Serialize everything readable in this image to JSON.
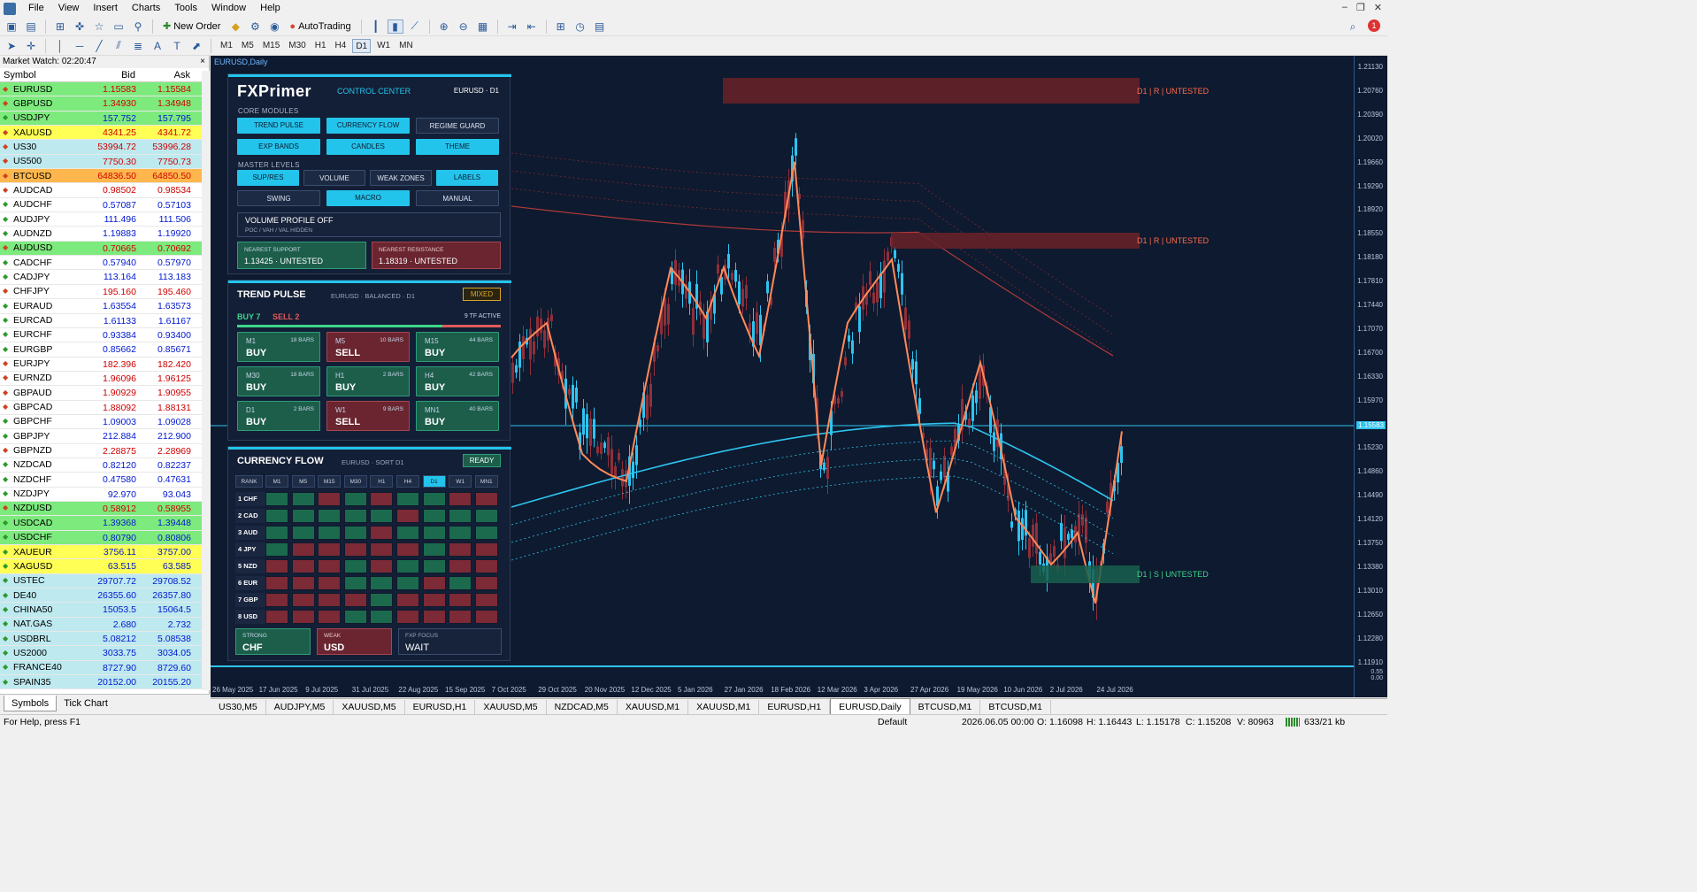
{
  "menu": [
    "File",
    "View",
    "Insert",
    "Charts",
    "Tools",
    "Window",
    "Help"
  ],
  "toolbar": {
    "new_order": "New Order",
    "autotrading": "AutoTrading",
    "timeframes": [
      "M1",
      "M5",
      "M15",
      "M30",
      "H1",
      "H4",
      "D1",
      "W1",
      "MN"
    ],
    "active_tf": "D1"
  },
  "market_watch": {
    "title": "Market Watch: 02:20:47",
    "col_symbol": "Symbol",
    "col_bid": "Bid",
    "col_ask": "Ask",
    "rows": [
      {
        "s": "EURUSD",
        "b": "1.15583",
        "a": "1.15584",
        "bg": "#7dea7d",
        "dir": "dn"
      },
      {
        "s": "GBPUSD",
        "b": "1.34930",
        "a": "1.34948",
        "bg": "#7dea7d",
        "dir": "dn"
      },
      {
        "s": "USDJPY",
        "b": "157.752",
        "a": "157.795",
        "bg": "#7dea7d",
        "dir": "up"
      },
      {
        "s": "XAUUSD",
        "b": "4341.25",
        "a": "4341.72",
        "bg": "#ffff55",
        "dir": "dn"
      },
      {
        "s": "US30",
        "b": "53994.72",
        "a": "53996.28",
        "bg": "#bde9ef",
        "dir": "dn"
      },
      {
        "s": "US500",
        "b": "7750.30",
        "a": "7750.73",
        "bg": "#bde9ef",
        "dir": "dn"
      },
      {
        "s": "BTCUSD",
        "b": "64836.50",
        "a": "64850.50",
        "bg": "#ffb74d",
        "dir": "dn"
      },
      {
        "s": "AUDCAD",
        "b": "0.98502",
        "a": "0.98534",
        "bg": "#ffffff",
        "dir": "dn"
      },
      {
        "s": "AUDCHF",
        "b": "0.57087",
        "a": "0.57103",
        "bg": "#ffffff",
        "dir": "up"
      },
      {
        "s": "AUDJPY",
        "b": "111.496",
        "a": "111.506",
        "bg": "#ffffff",
        "dir": "up"
      },
      {
        "s": "AUDNZD",
        "b": "1.19883",
        "a": "1.19920",
        "bg": "#ffffff",
        "dir": "up"
      },
      {
        "s": "AUDUSD",
        "b": "0.70665",
        "a": "0.70692",
        "bg": "#7dea7d",
        "dir": "dn"
      },
      {
        "s": "CADCHF",
        "b": "0.57940",
        "a": "0.57970",
        "bg": "#ffffff",
        "dir": "up"
      },
      {
        "s": "CADJPY",
        "b": "113.164",
        "a": "113.183",
        "bg": "#ffffff",
        "dir": "up"
      },
      {
        "s": "CHFJPY",
        "b": "195.160",
        "a": "195.460",
        "bg": "#ffffff",
        "dir": "dn"
      },
      {
        "s": "EURAUD",
        "b": "1.63554",
        "a": "1.63573",
        "bg": "#ffffff",
        "dir": "up"
      },
      {
        "s": "EURCAD",
        "b": "1.61133",
        "a": "1.61167",
        "bg": "#ffffff",
        "dir": "up"
      },
      {
        "s": "EURCHF",
        "b": "0.93384",
        "a": "0.93400",
        "bg": "#ffffff",
        "dir": "up"
      },
      {
        "s": "EURGBP",
        "b": "0.85662",
        "a": "0.85671",
        "bg": "#ffffff",
        "dir": "up"
      },
      {
        "s": "EURJPY",
        "b": "182.396",
        "a": "182.420",
        "bg": "#ffffff",
        "dir": "dn"
      },
      {
        "s": "EURNZD",
        "b": "1.96096",
        "a": "1.96125",
        "bg": "#ffffff",
        "dir": "dn"
      },
      {
        "s": "GBPAUD",
        "b": "1.90929",
        "a": "1.90955",
        "bg": "#ffffff",
        "dir": "dn"
      },
      {
        "s": "GBPCAD",
        "b": "1.88092",
        "a": "1.88131",
        "bg": "#ffffff",
        "dir": "dn"
      },
      {
        "s": "GBPCHF",
        "b": "1.09003",
        "a": "1.09028",
        "bg": "#ffffff",
        "dir": "up"
      },
      {
        "s": "GBPJPY",
        "b": "212.884",
        "a": "212.900",
        "bg": "#ffffff",
        "dir": "up"
      },
      {
        "s": "GBPNZD",
        "b": "2.28875",
        "a": "2.28969",
        "bg": "#ffffff",
        "dir": "dn"
      },
      {
        "s": "NZDCAD",
        "b": "0.82120",
        "a": "0.82237",
        "bg": "#ffffff",
        "dir": "up"
      },
      {
        "s": "NZDCHF",
        "b": "0.47580",
        "a": "0.47631",
        "bg": "#ffffff",
        "dir": "up"
      },
      {
        "s": "NZDJPY",
        "b": "92.970",
        "a": "93.043",
        "bg": "#ffffff",
        "dir": "up"
      },
      {
        "s": "NZDUSD",
        "b": "0.58912",
        "a": "0.58955",
        "bg": "#7dea7d",
        "dir": "dn"
      },
      {
        "s": "USDCAD",
        "b": "1.39368",
        "a": "1.39448",
        "bg": "#7dea7d",
        "dir": "up"
      },
      {
        "s": "USDCHF",
        "b": "0.80790",
        "a": "0.80806",
        "bg": "#7dea7d",
        "dir": "up"
      },
      {
        "s": "XAUEUR",
        "b": "3756.11",
        "a": "3757.00",
        "bg": "#ffff55",
        "dir": "up"
      },
      {
        "s": "XAGUSD",
        "b": "63.515",
        "a": "63.585",
        "bg": "#ffff55",
        "dir": "up"
      },
      {
        "s": "USTEC",
        "b": "29707.72",
        "a": "29708.52",
        "bg": "#bde9ef",
        "dir": "up"
      },
      {
        "s": "DE40",
        "b": "26355.60",
        "a": "26357.80",
        "bg": "#bde9ef",
        "dir": "up"
      },
      {
        "s": "CHINA50",
        "b": "15053.5",
        "a": "15064.5",
        "bg": "#bde9ef",
        "dir": "up"
      },
      {
        "s": "NAT.GAS",
        "b": "2.680",
        "a": "2.732",
        "bg": "#bde9ef",
        "dir": "up"
      },
      {
        "s": "USDBRL",
        "b": "5.08212",
        "a": "5.08538",
        "bg": "#bde9ef",
        "dir": "up"
      },
      {
        "s": "US2000",
        "b": "3033.75",
        "a": "3034.05",
        "bg": "#bde9ef",
        "dir": "up"
      },
      {
        "s": "FRANCE40",
        "b": "8727.90",
        "a": "8729.60",
        "bg": "#bde9ef",
        "dir": "up"
      },
      {
        "s": "SPAIN35",
        "b": "20152.00",
        "a": "20155.20",
        "bg": "#bde9ef",
        "dir": "up"
      }
    ],
    "tabs": [
      "Symbols",
      "Tick Chart"
    ]
  },
  "chart": {
    "title": "EURUSD,Daily",
    "price_labels": [
      "1.21130",
      "1.20760",
      "1.20390",
      "1.20020",
      "1.19660",
      "1.19290",
      "1.18920",
      "1.18550",
      "1.18180",
      "1.17810",
      "1.17440",
      "1.17070",
      "1.16700",
      "1.16330",
      "1.15970",
      "1.15583",
      "1.15230",
      "1.14860",
      "1.14490",
      "1.14120",
      "1.13750",
      "1.13380",
      "1.13010",
      "1.12650",
      "1.12280",
      "1.11910"
    ],
    "current_price": "1.15583",
    "x_labels": [
      "26 May 2025",
      "17 Jun 2025",
      "9 Jul 2025",
      "31 Jul 2025",
      "22 Aug 2025",
      "15 Sep 2025",
      "7 Oct 2025",
      "29 Oct 2025",
      "20 Nov 2025",
      "12 Dec 2025",
      "5 Jan 2026",
      "27 Jan 2026",
      "18 Feb 2026",
      "12 Mar 2026",
      "3 Apr 2026",
      "27 Apr 2026",
      "19 May 2026",
      "10 Jun 2026",
      "2 Jul 2026",
      "24 Jul 2026"
    ],
    "zones": [
      {
        "label": "D1 | R | UNTESTED",
        "price": "1.20760"
      },
      {
        "label": "D1 | R | UNTESTED",
        "price": "1.18550"
      },
      {
        "label": "D1 | S | UNTESTED",
        "price": "1.13380"
      }
    ],
    "sub_labels": [
      "0.55",
      "0.00"
    ]
  },
  "control": {
    "brand": "FXPrimer",
    "subtitle": "CONTROL CENTER",
    "pair": "EURUSD · D1",
    "core_label": "CORE MODULES",
    "core": [
      {
        "l": "TREND PULSE",
        "on": true
      },
      {
        "l": "CURRENCY FLOW",
        "on": true
      },
      {
        "l": "REGIME GUARD",
        "on": false
      },
      {
        "l": "EXP BANDS",
        "on": true
      },
      {
        "l": "CANDLES",
        "on": true
      },
      {
        "l": "THEME",
        "on": true
      }
    ],
    "master_label": "MASTER LEVELS",
    "master": [
      {
        "l": "SUP/RES",
        "on": true
      },
      {
        "l": "VOLUME",
        "on": false
      },
      {
        "l": "WEAK ZONES",
        "on": false
      },
      {
        "l": "LABELS",
        "on": true
      },
      {
        "l": "SWING",
        "on": false
      },
      {
        "l": "MACRO",
        "on": true
      },
      {
        "l": "MANUAL",
        "on": false
      }
    ],
    "vp_title": "VOLUME PROFILE OFF",
    "vp_sub": "POC / VAH / VAL HIDDEN",
    "support_label": "NEAREST SUPPORT",
    "support_val": "1.13425  ·  UNTESTED",
    "resist_label": "NEAREST RESISTANCE",
    "resist_val": "1.18319  ·  UNTESTED"
  },
  "trend": {
    "title": "TREND PULSE",
    "meta": "EURUSD · BALANCED · D1",
    "badge": "MIXED",
    "buy": "BUY 7",
    "sell": "SELL 2",
    "active": "9 TF ACTIVE",
    "tiles": [
      {
        "tf": "M1",
        "bars": "18 BARS",
        "sig": "BUY"
      },
      {
        "tf": "M5",
        "bars": "10 BARS",
        "sig": "SELL"
      },
      {
        "tf": "M15",
        "bars": "44 BARS",
        "sig": "BUY"
      },
      {
        "tf": "M30",
        "bars": "18 BARS",
        "sig": "BUY"
      },
      {
        "tf": "H1",
        "bars": "2 BARS",
        "sig": "BUY"
      },
      {
        "tf": "H4",
        "bars": "42 BARS",
        "sig": "BUY"
      },
      {
        "tf": "D1",
        "bars": "2 BARS",
        "sig": "BUY"
      },
      {
        "tf": "W1",
        "bars": "9 BARS",
        "sig": "SELL"
      },
      {
        "tf": "MN1",
        "bars": "40 BARS",
        "sig": "BUY"
      }
    ]
  },
  "flow": {
    "title": "CURRENCY FLOW",
    "meta": "EURUSD · SORT D1",
    "badge": "READY",
    "cols": [
      "RANK",
      "M1",
      "M5",
      "M15",
      "M30",
      "H1",
      "H4",
      "D1",
      "W1",
      "MN1"
    ],
    "active_col": "D1",
    "rows": [
      {
        "r": "1 CHF",
        "c": "GGSGSGGSS"
      },
      {
        "r": "2 CAD",
        "c": "GGGGGSGGG"
      },
      {
        "r": "3 AUD",
        "c": "GGGGSGGGG"
      },
      {
        "r": "4 JPY",
        "c": "GSSSSSGSS"
      },
      {
        "r": "5 NZD",
        "c": "SSSGSGGSS"
      },
      {
        "r": "6 EUR",
        "c": "SSSGGGSGS"
      },
      {
        "r": "7 GBP",
        "c": "SSSSGSSSS"
      },
      {
        "r": "8 USD",
        "c": "SSSGGSSSS"
      }
    ],
    "strong_label": "STRONG",
    "strong": "CHF",
    "weak_label": "WEAK",
    "weak": "USD",
    "focus_label": "FXP FOCUS",
    "focus": "WAIT"
  },
  "chart_tabs": [
    "US30,M5",
    "AUDJPY,M5",
    "XAUUSD,M5",
    "EURUSD,H1",
    "XAUUSD,M5",
    "NZDCAD,M5",
    "XAUUSD,M1",
    "XAUUSD,M1",
    "EURUSD,H1",
    "EURUSD,Daily",
    "BTCUSD,M1",
    "BTCUSD,M1"
  ],
  "active_chart_tab": "EURUSD,Daily",
  "status": {
    "help": "For Help, press F1",
    "profile": "Default",
    "time": "2026.06.05 00:00",
    "o": "O: 1.16098",
    "h": "H: 1.16443",
    "l": "L: 1.15178",
    "c": "C: 1.15208",
    "v": "V: 80963",
    "net": "633/21 kb"
  },
  "colors": {
    "bg": "#0e1a2f",
    "buy": "#1c5e4a",
    "sell": "#6a2530",
    "accent": "#23c4ec",
    "bull": "#2ec4f0",
    "bear": "#8f2f3a"
  }
}
